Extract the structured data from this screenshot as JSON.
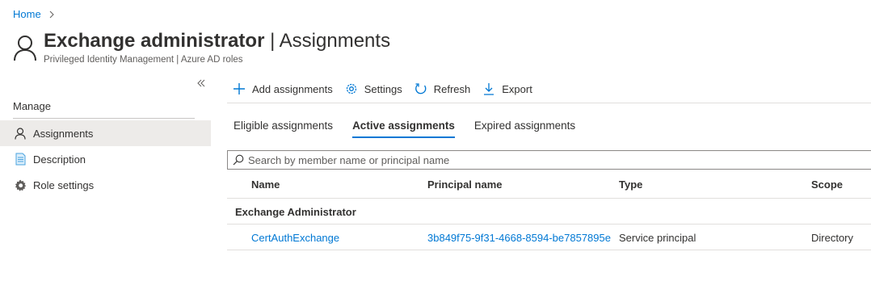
{
  "breadcrumb": {
    "home": "Home"
  },
  "header": {
    "title_strong": "Exchange administrator",
    "title_separator": "|",
    "title_section": "Assignments",
    "subtitle": "Privileged Identity Management | Azure AD roles"
  },
  "sidebar": {
    "section_label": "Manage",
    "items": [
      {
        "label": "Assignments",
        "icon": "person-icon",
        "selected": true
      },
      {
        "label": "Description",
        "icon": "document-icon",
        "selected": false
      },
      {
        "label": "Role settings",
        "icon": "gear-icon",
        "selected": false
      }
    ]
  },
  "commands": [
    {
      "label": "Add assignments",
      "icon": "plus-icon"
    },
    {
      "label": "Settings",
      "icon": "gear-icon"
    },
    {
      "label": "Refresh",
      "icon": "refresh-icon"
    },
    {
      "label": "Export",
      "icon": "download-icon"
    }
  ],
  "tabs": [
    {
      "label": "Eligible assignments",
      "active": false
    },
    {
      "label": "Active assignments",
      "active": true
    },
    {
      "label": "Expired assignments",
      "active": false
    }
  ],
  "search": {
    "placeholder": "Search by member name or principal name",
    "value": ""
  },
  "table": {
    "columns": [
      "Name",
      "Principal name",
      "Type",
      "Scope"
    ],
    "groups": [
      {
        "label": "Exchange Administrator",
        "rows": [
          {
            "name": "CertAuthExchange",
            "principal": "3b849f75-9f31-4668-8594-be7857895e",
            "type": "Service principal",
            "scope": "Directory"
          }
        ]
      }
    ]
  },
  "colors": {
    "accent": "#0078d4",
    "selected_bg": "#edebe9",
    "text": "#323130"
  }
}
